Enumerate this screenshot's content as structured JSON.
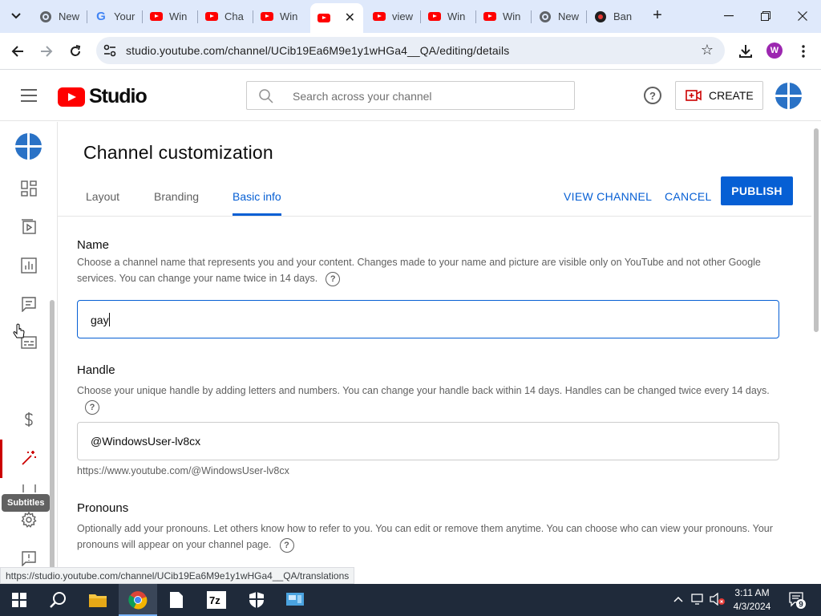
{
  "browser": {
    "tabs": [
      {
        "label": "New",
        "icon": "chrome-icon"
      },
      {
        "label": "Your",
        "icon": "google-icon"
      },
      {
        "label": "Win",
        "icon": "youtube-icon"
      },
      {
        "label": "Cha",
        "icon": "youtube-icon"
      },
      {
        "label": "Win",
        "icon": "youtube-icon"
      },
      {
        "label": "",
        "icon": "youtube-icon",
        "active": true
      },
      {
        "label": "view",
        "icon": "youtube-icon"
      },
      {
        "label": "Win",
        "icon": "youtube-icon"
      },
      {
        "label": "Win",
        "icon": "youtube-icon"
      },
      {
        "label": "New",
        "icon": "chrome-icon"
      },
      {
        "label": "Ban",
        "icon": "record-icon"
      }
    ],
    "url": "studio.youtube.com/channel/UCib19Ea6M9e1y1wHGa4__QA/editing/details",
    "profile_initial": "W",
    "status_url": "https://studio.youtube.com/channel/UCib19Ea6M9e1y1wHGa4__QA/translations"
  },
  "header": {
    "logo_text": "Studio",
    "search_placeholder": "Search across your channel",
    "create_label": "CREATE",
    "help_symbol": "?"
  },
  "leftnav": {
    "tooltip": "Subtitles"
  },
  "page": {
    "title": "Channel customization",
    "tabs": [
      "Layout",
      "Branding",
      "Basic info"
    ],
    "view_channel": "VIEW CHANNEL",
    "cancel": "CANCEL",
    "publish": "PUBLISH"
  },
  "name_section": {
    "title": "Name",
    "desc": "Choose a channel name that represents you and your content. Changes made to your name and picture are visible only on YouTube and not other Google services. You can change your name twice in 14 days.",
    "value": "gay"
  },
  "handle_section": {
    "title": "Handle",
    "desc": "Choose your unique handle by adding letters and numbers. You can change your handle back within 14 days. Handles can be changed twice every 14 days.",
    "value": "@WindowsUser-lv8cx",
    "url": "https://www.youtube.com/@WindowsUser-lv8cx"
  },
  "pronouns_section": {
    "title": "Pronouns",
    "desc": "Optionally add your pronouns. Let others know how to refer to you. You can edit or remove them anytime. You can choose who can view your pronouns. Your pronouns will appear on your channel page."
  },
  "taskbar": {
    "time": "3:11 AM",
    "date": "4/3/2024",
    "notification_count": "9"
  },
  "colors": {
    "accent": "#065fd4",
    "youtube_red": "#ff0000",
    "active_nav": "#cc0000",
    "avatar": "#2a72c6"
  }
}
